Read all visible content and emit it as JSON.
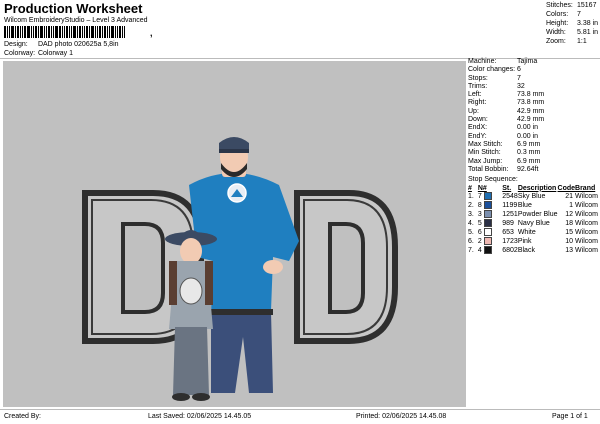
{
  "header": {
    "title": "Production Worksheet",
    "subtitle": "Wilcom EmbroideryStudio – Level 3 Advanced",
    "barcode_suffix": ","
  },
  "meta": {
    "design_label": "Design:",
    "design_value": "DAD photo 020625a 5,8in",
    "colorway_label": "Colorway:",
    "colorway_value": "Colorway 1"
  },
  "summary": [
    {
      "label": "Stitches:",
      "value": "15167"
    },
    {
      "label": "Colors:",
      "value": "7"
    },
    {
      "label": "Height:",
      "value": "3.38 in"
    },
    {
      "label": "Width:",
      "value": "5.81 in"
    },
    {
      "label": "Zoom:",
      "value": "1:1"
    }
  ],
  "details": [
    {
      "label": "Machine:",
      "value": "Tajima"
    },
    {
      "label": "Color changes:",
      "value": "6"
    },
    {
      "label": "Stops:",
      "value": "7"
    },
    {
      "label": "Trims:",
      "value": "32"
    },
    {
      "label": "Left:",
      "value": "73.8 mm"
    },
    {
      "label": "Right:",
      "value": "73.8 mm"
    },
    {
      "label": "Up:",
      "value": "42.9 mm"
    },
    {
      "label": "Down:",
      "value": "42.9 mm"
    },
    {
      "label": "EndX:",
      "value": "0.00 in"
    },
    {
      "label": "EndY:",
      "value": "0.00 in"
    },
    {
      "label": "Max Stitch:",
      "value": "6.9 mm"
    },
    {
      "label": "Min Stitch:",
      "value": "0.3 mm"
    },
    {
      "label": "Max Jump:",
      "value": "6.9 mm"
    },
    {
      "label": "Total Bobbin:",
      "value": "92.64ft"
    }
  ],
  "stop_sequence": {
    "title": "Stop Sequence:",
    "columns": [
      "#",
      "N#",
      "St.",
      "Description",
      "Code",
      "Brand"
    ],
    "rows": [
      {
        "num": "1.",
        "n": "7",
        "color": "#1f6eb0",
        "st": "2548",
        "desc": "Sky Blue",
        "code": "21",
        "brand": "Wilcom"
      },
      {
        "num": "2.",
        "n": "8",
        "color": "#1a4f9a",
        "st": "1199",
        "desc": "Blue",
        "code": "1",
        "brand": "Wilcom"
      },
      {
        "num": "3.",
        "n": "3",
        "color": "#7b8fae",
        "st": "1251",
        "desc": "Powder Blue",
        "code": "12",
        "brand": "Wilcom"
      },
      {
        "num": "4.",
        "n": "5",
        "color": "#2a2f45",
        "st": "989",
        "desc": "Navy Blue",
        "code": "18",
        "brand": "Wilcom"
      },
      {
        "num": "5.",
        "n": "6",
        "color": "#ffffff",
        "st": "653",
        "desc": "White",
        "code": "15",
        "brand": "Wilcom"
      },
      {
        "num": "6.",
        "n": "2",
        "color": "#f0b9b3",
        "st": "1723",
        "desc": "Pink",
        "code": "10",
        "brand": "Wilcom"
      },
      {
        "num": "7.",
        "n": "4",
        "color": "#111111",
        "st": "6802",
        "desc": "Black",
        "code": "13",
        "brand": "Wilcom"
      }
    ]
  },
  "footer": {
    "created_by": "Created By:",
    "last_saved": "Last Saved: 02/06/2025 14.45.05",
    "printed": "Printed: 02/06/2025 14.45.08",
    "page": "Page 1 of 1"
  },
  "colors": {
    "canvas_bg": "#c0c0c0",
    "letter_outline": "#333333",
    "letter_fill": "#c7c7c7",
    "shirt": "#1f7fc0",
    "jeans": "#3b4f7a",
    "hat": "#3b4a63"
  }
}
